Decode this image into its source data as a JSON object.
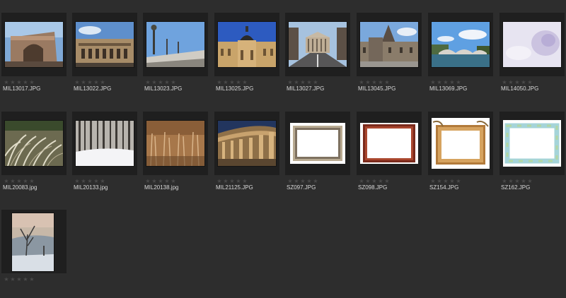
{
  "colors": {
    "background": "#2d2d2d",
    "frame": "#1f1f1f",
    "text": "#d8d8d8",
    "star": "#4a4a4a"
  },
  "rating_icon": "star-icon",
  "files": [
    {
      "name": "MIL13017.JPG",
      "rating": 0
    },
    {
      "name": "MIL13022.JPG",
      "rating": 0
    },
    {
      "name": "MIL13023.JPG",
      "rating": 0
    },
    {
      "name": "MIL13025.JPG",
      "rating": 0
    },
    {
      "name": "MIL13027.JPG",
      "rating": 0
    },
    {
      "name": "MIL13045.JPG",
      "rating": 0
    },
    {
      "name": "MIL13069.JPG",
      "rating": 0
    },
    {
      "name": "MIL14050.JPG",
      "rating": 0
    },
    {
      "name": "MIL20083.jpg",
      "rating": 0
    },
    {
      "name": "MIL20133.jpg",
      "rating": 0
    },
    {
      "name": "MIL20138.jpg",
      "rating": 0
    },
    {
      "name": "MIL21125.JPG",
      "rating": 0
    },
    {
      "name": "SZ097.JPG",
      "rating": 0
    },
    {
      "name": "SZ098.JPG",
      "rating": 0
    },
    {
      "name": "SZ154.JPG",
      "rating": 0
    },
    {
      "name": "SZ162.JPG",
      "rating": 0
    },
    {
      "name": "",
      "rating": 0
    }
  ]
}
